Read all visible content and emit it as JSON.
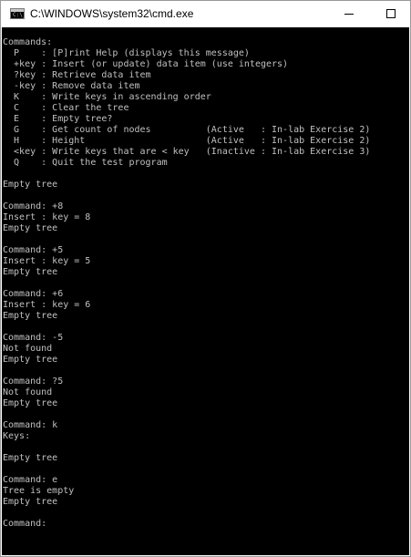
{
  "window": {
    "title": "C:\\WINDOWS\\system32\\cmd.exe",
    "icon": "cmd-app-icon",
    "icon_prompt": "C:\\_",
    "text_color": "#c0c0c0",
    "background_color": "#000000"
  },
  "console": {
    "lines": [
      "Commands:",
      "  P    : [P]rint Help (displays this message)",
      "  +key : Insert (or update) data item (use integers)",
      "  ?key : Retrieve data item",
      "  -key : Remove data item",
      "  K    : Write keys in ascending order",
      "  C    : Clear the tree",
      "  E    : Empty tree?",
      "  G    : Get count of nodes          (Active   : In-lab Exercise 2)",
      "  H    : Height                      (Active   : In-lab Exercise 2)",
      "  <key : Write keys that are < key   (Inactive : In-lab Exercise 3)",
      "  Q    : Quit the test program",
      "",
      "Empty tree",
      "",
      "Command: +8",
      "Insert : key = 8",
      "Empty tree",
      "",
      "Command: +5",
      "Insert : key = 5",
      "Empty tree",
      "",
      "Command: +6",
      "Insert : key = 6",
      "Empty tree",
      "",
      "Command: -5",
      "Not found",
      "Empty tree",
      "",
      "Command: ?5",
      "Not found",
      "Empty tree",
      "",
      "Command: k",
      "Keys:",
      "",
      "Empty tree",
      "",
      "Command: e",
      "Tree is empty",
      "Empty tree",
      "",
      "Command: "
    ]
  }
}
